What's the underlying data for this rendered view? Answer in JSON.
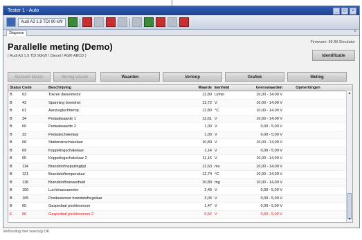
{
  "window": {
    "title": "Tester 1 - Auto"
  },
  "toolbar": {
    "search_value": "Audi A3 1.9 TDI 90 kW"
  },
  "tab": {
    "label": "Diagnose"
  },
  "page": {
    "title": "Parallelle meting (Demo)",
    "subtitle": "( Audi A3 1.9 TDI 90kW / Diesel / AGR-ABCD )",
    "firmware": "Firmware: 99.99 Simulator"
  },
  "buttons": {
    "identification": "Identificatie",
    "disabled1": "Systeem kiezen",
    "disabled2": "Storing wissen",
    "tab1": "Waarden",
    "tab2": "Verloop",
    "tab3": "Grafiek",
    "tab4": "Meting"
  },
  "table": {
    "headers": {
      "status": "Status",
      "code": "Code",
      "desc": "Beschrijving",
      "val": "Waarde",
      "unit": "Eenheid",
      "range": "Grenswaarden",
      "comment": "Opmerkingen"
    },
    "rows": [
      {
        "status": "B",
        "code": "63",
        "desc": "Toeren dieselmotor",
        "val": "13,80",
        "unit": "U/min",
        "range": "10,00 - 14,00 V",
        "comment": ""
      },
      {
        "status": "B",
        "code": "43",
        "desc": "Spanning boordnet",
        "val": "13,72",
        "unit": "V",
        "range": "10,00 - 14,00 V",
        "comment": ""
      },
      {
        "status": "B",
        "code": "61",
        "desc": "Aanzuigluchttemp.",
        "val": "12,80",
        "unit": "°C",
        "range": "10,00 - 14,00 V",
        "comment": ""
      },
      {
        "status": "B",
        "code": "34",
        "desc": "Pedaalwaarde 1",
        "val": "13,61",
        "unit": "V",
        "range": "10,00 - 14,00 V",
        "comment": ""
      },
      {
        "status": "B",
        "code": "60",
        "desc": "Pedaalwaarde 2",
        "val": "1,00",
        "unit": "V",
        "range": "0,00 - 5,00 V",
        "comment": ""
      },
      {
        "status": "B",
        "code": "33",
        "desc": "Pedaalschakelaar",
        "val": "1,00",
        "unit": "V",
        "range": "0,00 - 5,00 V",
        "comment": ""
      },
      {
        "status": "B",
        "code": "68",
        "desc": "Stationairschakelaar",
        "val": "10,80",
        "unit": "V",
        "range": "10,00 - 14,00 V",
        "comment": ""
      },
      {
        "status": "B",
        "code": "69",
        "desc": "Koppelingschakelaar",
        "val": "1,14",
        "unit": "V",
        "range": "0,00 - 5,00 V",
        "comment": ""
      },
      {
        "status": "B",
        "code": "65",
        "desc": "Koppelingschakelaar 2",
        "val": "11,16",
        "unit": "V",
        "range": "10,00 - 14,00 V",
        "comment": ""
      },
      {
        "status": "B",
        "code": "114",
        "desc": "Brandstofinspuitingtijd",
        "val": "12,63",
        "unit": "ms",
        "range": "10,00 - 14,00 V",
        "comment": ""
      },
      {
        "status": "B",
        "code": "121",
        "desc": "Brandstoftemperatuur",
        "val": "12,74",
        "unit": "°C",
        "range": "10,00 - 14,00 V",
        "comment": ""
      },
      {
        "status": "B",
        "code": "118",
        "desc": "Brandstofhoeveelheid",
        "val": "10,89",
        "unit": "mg",
        "range": "10,00 - 14,00 V",
        "comment": ""
      },
      {
        "status": "B",
        "code": "106",
        "desc": "Luchtmassameter",
        "val": "2,49",
        "unit": "V",
        "range": "0,00 - 5,00 V",
        "comment": ""
      },
      {
        "status": "B",
        "code": "105",
        "desc": "Positiesensor brandstofregelaar",
        "val": "3,03",
        "unit": "V",
        "range": "0,00 - 5,00 V",
        "comment": ""
      },
      {
        "status": "B",
        "code": "65",
        "desc": "Gaspedaal positiesensor",
        "val": "1,47",
        "unit": "V",
        "range": "0,00 - 5,00 V",
        "comment": ""
      },
      {
        "status": "E",
        "code": "66",
        "desc": "Gaspedaal positiesensor 2",
        "val": "0,52",
        "unit": "V",
        "range": "0,60 - 5,00 V",
        "comment": ""
      }
    ]
  },
  "status": {
    "text": "Verbinding met voertuig OK"
  },
  "colors": {
    "alert": "#d41a1a",
    "titlebar": "#2f5fb8"
  }
}
